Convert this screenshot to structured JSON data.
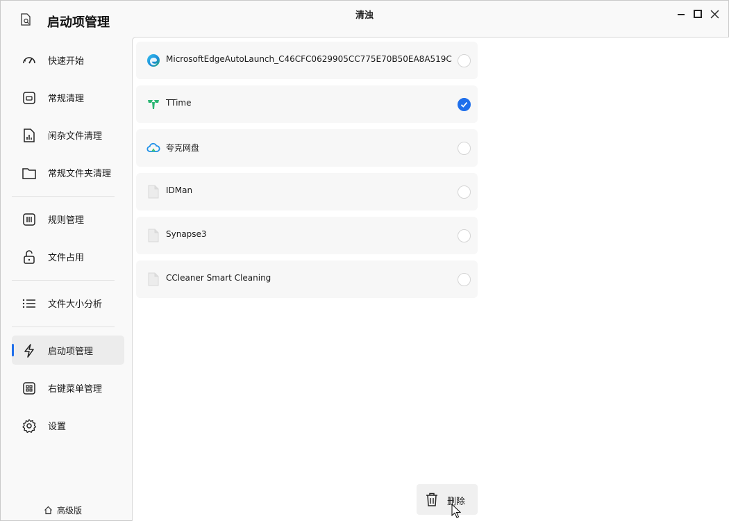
{
  "app": {
    "title": "启动项管理",
    "window_title": "清浊"
  },
  "sidebar": {
    "items": [
      {
        "label": "快速开始",
        "icon": "gauge-icon"
      },
      {
        "label": "常规清理",
        "icon": "cleanup-box-icon"
      },
      {
        "label": "闲杂文件清理",
        "icon": "file-chart-icon"
      },
      {
        "label": "常规文件夹清理",
        "icon": "folder-icon"
      },
      {
        "label": "规则管理",
        "icon": "columns-icon"
      },
      {
        "label": "文件占用",
        "icon": "unlock-icon"
      },
      {
        "label": "文件大小分析",
        "icon": "list-icon"
      },
      {
        "label": "启动项管理",
        "icon": "lightning-icon"
      },
      {
        "label": "右键菜单管理",
        "icon": "grid-menu-icon"
      },
      {
        "label": "设置",
        "icon": "gear-icon"
      }
    ],
    "active_index": 7,
    "premium_label": "高级版"
  },
  "startup_items": [
    {
      "name": "MicrosoftEdgeAutoLaunch_C46CFC0629905CC775E70B50EA8A519C",
      "icon": "edge-icon",
      "checked": false
    },
    {
      "name": "TTime",
      "icon": "ttime-icon",
      "checked": true
    },
    {
      "name": "夸克网盘",
      "icon": "cloud-icon",
      "checked": false
    },
    {
      "name": "IDMan",
      "icon": "file-icon",
      "checked": false
    },
    {
      "name": "Synapse3",
      "icon": "file-icon",
      "checked": false
    },
    {
      "name": "CCleaner Smart Cleaning",
      "icon": "file-icon",
      "checked": false
    }
  ],
  "actions": {
    "delete_label": "删除"
  },
  "colors": {
    "accent": "#1f6feb",
    "ttime_green": "#2bb673"
  }
}
